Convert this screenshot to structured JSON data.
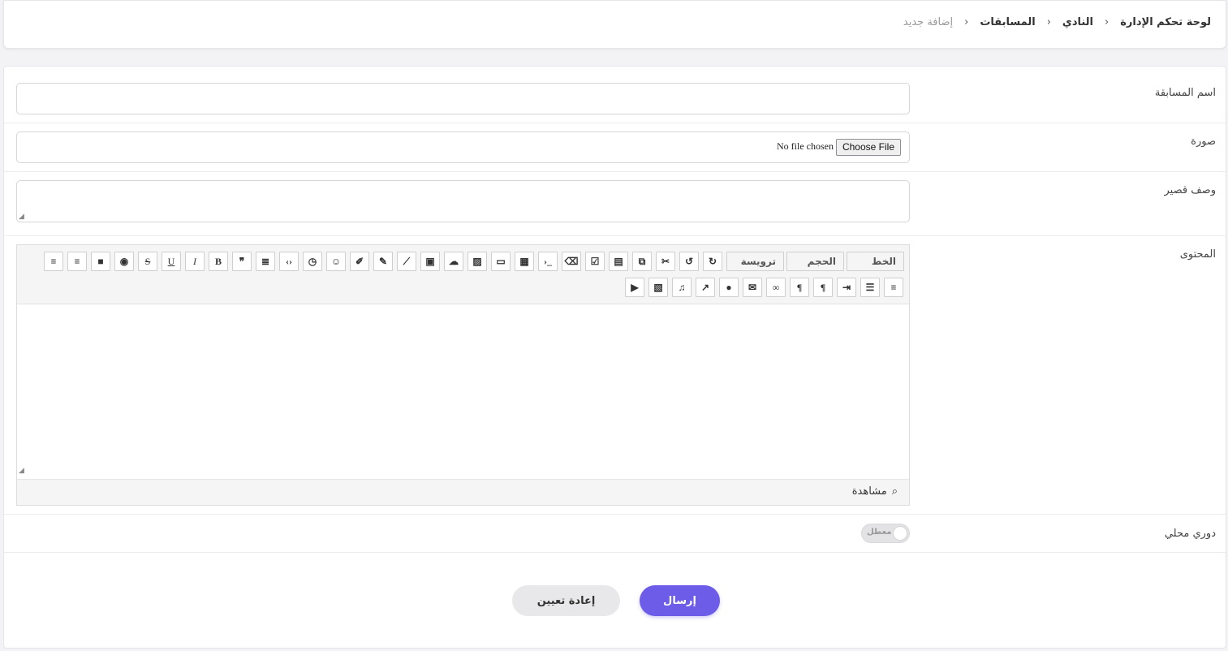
{
  "breadcrumb": {
    "items": [
      "لوحة تحكم الإدارة",
      "النادي",
      "المسابقات"
    ],
    "current": "إضافة جديد",
    "separator": "›"
  },
  "form": {
    "name_label": "اسم المسابقة",
    "name_value": "",
    "image_label": "صورة",
    "file_button": "Choose File",
    "file_status": "No file chosen",
    "short_desc_label": "وصف قصير",
    "content_label": "المحتوى",
    "local_league_label": "دوري محلي",
    "toggle_state": "معطل"
  },
  "editor": {
    "font_select": "الخط",
    "size_select": "الحجم",
    "heading_select": "ترويسة",
    "preview_label": "مشاهدة"
  },
  "buttons": {
    "submit": "إرسال",
    "reset": "إعادة تعيين"
  },
  "colors": {
    "accent": "#6c5ce7"
  }
}
